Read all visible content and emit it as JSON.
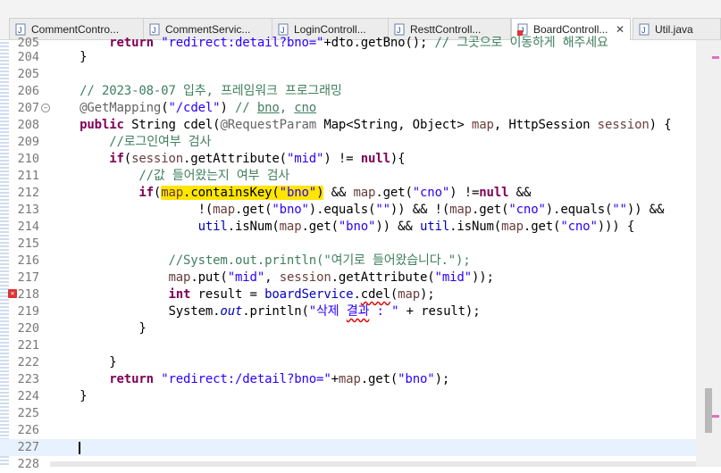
{
  "tabs": [
    {
      "label": "CommentContro...",
      "active": false,
      "icon": "java-file-icon"
    },
    {
      "label": "CommentServic...",
      "active": false,
      "icon": "java-file-icon"
    },
    {
      "label": "LoginControll...",
      "active": false,
      "icon": "java-file-icon"
    },
    {
      "label": "ResttControll...",
      "active": false,
      "icon": "java-file-icon"
    },
    {
      "label": "BoardControll...",
      "active": true,
      "icon": "java-file-error-icon",
      "close": "✕"
    },
    {
      "label": "Util.java",
      "active": false,
      "icon": "java-file-icon"
    }
  ],
  "lines": [
    {
      "n": "205",
      "t": "        return \"redirect:detail?bno=\"+dto.getBno(); // 그곳으로 이동하게 해주세요"
    },
    {
      "n": "204",
      "t": "    }"
    },
    {
      "n": "205",
      "t": ""
    },
    {
      "n": "206",
      "t": "    // 2023-08-07 입추, 프레임워크 프로그래밍"
    },
    {
      "n": "207",
      "t": "    @GetMapping(\"/cdel\") // bno, cno"
    },
    {
      "n": "208",
      "t": "    public String cdel(@RequestParam Map<String, Object> map, HttpSession session) {"
    },
    {
      "n": "209",
      "t": "        //로그인여부 검사"
    },
    {
      "n": "210",
      "t": "        if(session.getAttribute(\"mid\") != null){"
    },
    {
      "n": "211",
      "t": "            //값 들어왔는지 여부 검사"
    },
    {
      "n": "212",
      "t": "            if(map.containsKey(\"bno\") && map.get(\"cno\") !=null &&"
    },
    {
      "n": "213",
      "t": "                    !(map.get(\"bno\").equals(\"\")) && !(map.get(\"cno\").equals(\"\")) &&"
    },
    {
      "n": "214",
      "t": "                    util.isNum(map.get(\"bno\")) && util.isNum(map.get(\"cno\"))) {"
    },
    {
      "n": "215",
      "t": ""
    },
    {
      "n": "216",
      "t": "                //System.out.println(\"여기로 들어왔습니다.\");"
    },
    {
      "n": "217",
      "t": "                map.put(\"mid\", session.getAttribute(\"mid\"));"
    },
    {
      "n": "218",
      "t": "                int result = boardService.cdel(map);"
    },
    {
      "n": "219",
      "t": "                System.out.println(\"삭제 결과 : \" + result);"
    },
    {
      "n": "220",
      "t": "            }"
    },
    {
      "n": "221",
      "t": ""
    },
    {
      "n": "222",
      "t": "        }"
    },
    {
      "n": "223",
      "t": "        return \"redirect:/detail?bno=\"+map.get(\"bno\");"
    },
    {
      "n": "224",
      "t": "    }"
    },
    {
      "n": "225",
      "t": ""
    },
    {
      "n": "226",
      "t": ""
    },
    {
      "n": "227",
      "t": ""
    },
    {
      "n": "228",
      "t": ""
    }
  ],
  "colors": {
    "keyword": "#7f0055",
    "string": "#2a00ff",
    "comment": "#3f7f5f",
    "highlight": "#ffe600",
    "current_line": "#e8f2fe"
  }
}
